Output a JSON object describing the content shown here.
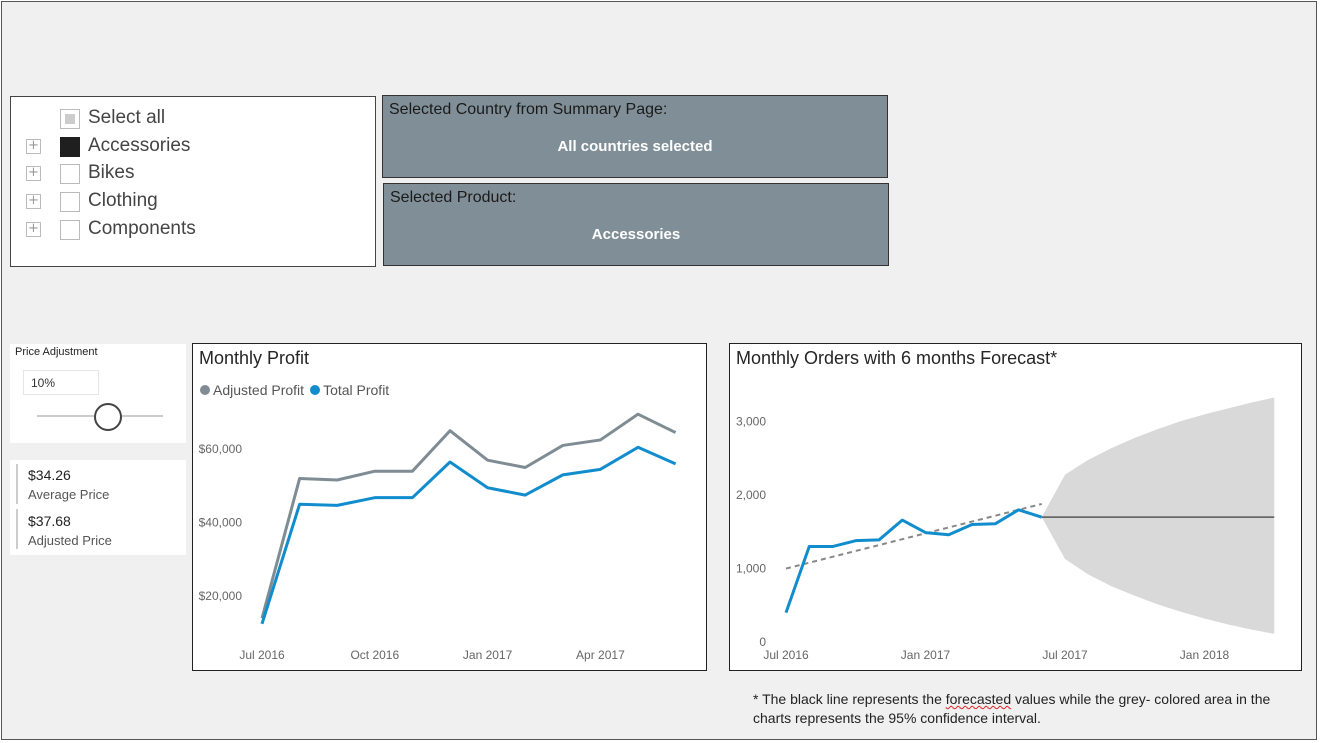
{
  "slicer": {
    "select_all": "Select all",
    "items": [
      {
        "label": "Accessories",
        "checked": true
      },
      {
        "label": "Bikes",
        "checked": false
      },
      {
        "label": "Clothing",
        "checked": false
      },
      {
        "label": "Components",
        "checked": false
      }
    ]
  },
  "cards": {
    "country_title": "Selected Country from Summary Page:",
    "country_value": "All countries selected",
    "product_title": "Selected Product:",
    "product_value": "Accessories"
  },
  "price_adjustment": {
    "label": "Price Adjustment",
    "value": "10%"
  },
  "kpis": {
    "average_price_value": "$34.26",
    "average_price_label": "Average Price",
    "adjusted_price_value": "$37.68",
    "adjusted_price_label": "Adjusted Price"
  },
  "colors": {
    "card_bg": "#808f97",
    "adjusted_profit": "#7f8c93",
    "total_profit": "#118dce",
    "forecast_band": "#d9d9d9",
    "forecast_line": "#555555"
  },
  "chart_data": [
    {
      "type": "line",
      "title": "Monthly Profit",
      "x": [
        "Jul 2016",
        "Aug 2016",
        "Sep 2016",
        "Oct 2016",
        "Nov 2016",
        "Dec 2016",
        "Jan 2017",
        "Feb 2017",
        "Mar 2017",
        "Apr 2017",
        "May 2017",
        "Jun 2017"
      ],
      "x_tick_labels": [
        "Jul 2016",
        "Oct 2016",
        "Jan 2017",
        "Apr 2017"
      ],
      "x_tick_indices": [
        0,
        3,
        6,
        9
      ],
      "series": [
        {
          "name": "Adjusted Profit",
          "values": [
            14000,
            52000,
            51600,
            54000,
            54000,
            65000,
            57000,
            55000,
            61000,
            62500,
            69500,
            64500
          ]
        },
        {
          "name": "Total Profit",
          "values": [
            12500,
            45000,
            44700,
            46800,
            46800,
            56500,
            49500,
            47500,
            53000,
            54500,
            60500,
            56000
          ]
        }
      ],
      "yticks": [
        20000,
        40000,
        60000
      ],
      "ytick_labels": [
        "$20,000",
        "$40,000",
        "$60,000"
      ],
      "ylim": [
        10000,
        72000
      ],
      "grid": false,
      "legend": "top-left"
    },
    {
      "type": "line",
      "title": "Monthly Orders with 6 months Forecast*",
      "x_tick_labels": [
        "Jul 2016",
        "Jan 2017",
        "Jul 2017",
        "Jan 2018"
      ],
      "x_tick_months": [
        0,
        6,
        12,
        18
      ],
      "series": [
        {
          "values_months": [
            0,
            1,
            2,
            3,
            4,
            5,
            6,
            7,
            8,
            9,
            10,
            11
          ],
          "values": [
            400,
            1300,
            1300,
            1380,
            1390,
            1660,
            1490,
            1460,
            1600,
            1610,
            1800,
            1700
          ]
        }
      ],
      "trend": {
        "from": [
          0,
          1000
        ],
        "to": [
          11,
          1880
        ]
      },
      "forecast": {
        "start_month": 11,
        "end_month": 21,
        "value": 1700,
        "upper": [
          1700,
          2280,
          2480,
          2640,
          2780,
          2900,
          3010,
          3100,
          3180,
          3260,
          3330
        ],
        "lower": [
          1700,
          1130,
          920,
          760,
          630,
          510,
          410,
          320,
          240,
          170,
          110
        ]
      },
      "yticks": [
        0,
        1000,
        2000,
        3000
      ],
      "ytick_labels": [
        "0",
        "1,000",
        "2,000",
        "3,000"
      ],
      "ylim": [
        0,
        3500
      ],
      "grid": false
    }
  ],
  "footnote": {
    "pre": "* The black line represents the ",
    "word": "forecasted",
    "post": " values while the grey- colored area in the charts represents the 95% confidence interval."
  }
}
